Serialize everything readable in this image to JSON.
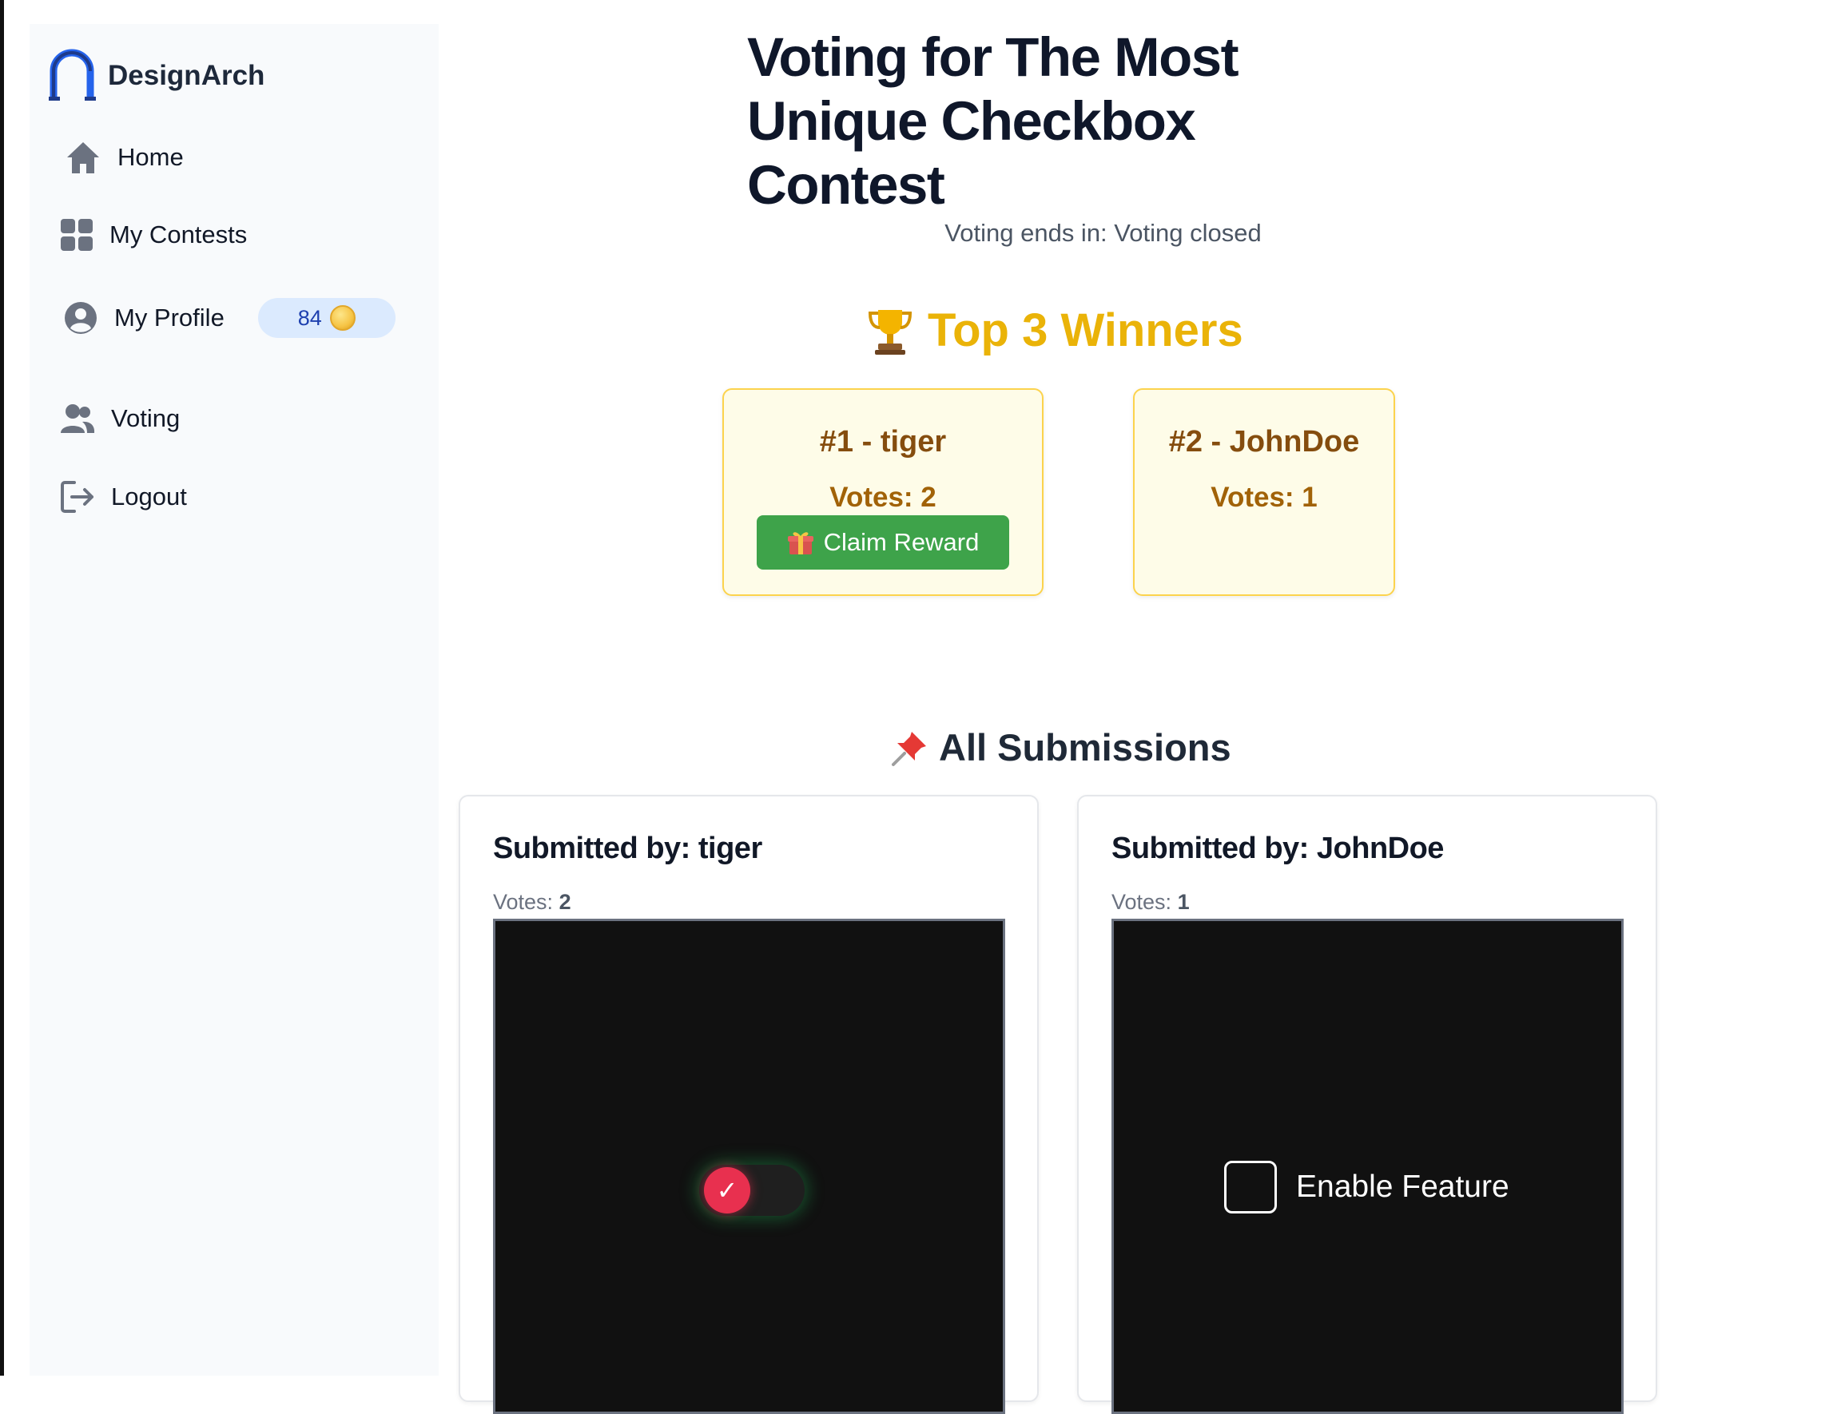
{
  "brand": {
    "name": "DesignArch"
  },
  "sidebar": {
    "items": [
      {
        "label": "Home",
        "icon": "home-icon"
      },
      {
        "label": "My Contests",
        "icon": "grid-icon"
      },
      {
        "label": "My Profile",
        "icon": "user-circle-icon",
        "badge": "84",
        "badge_icon": "coin-icon"
      },
      {
        "label": "Voting",
        "icon": "users-icon"
      },
      {
        "label": "Logout",
        "icon": "logout-icon"
      }
    ]
  },
  "header": {
    "title": "Voting for The Most Unique Checkbox Contest",
    "voting_ends": "Voting ends in: Voting closed"
  },
  "winners": {
    "title": "Top 3 Winners",
    "title_icon": "trophy-icon",
    "items": [
      {
        "title": "#1 - tiger",
        "votes": "Votes: 2",
        "claim_label": "Claim Reward",
        "claim_icon": "gift-icon"
      },
      {
        "title": "#2 - JohnDoe",
        "votes": "Votes: 1"
      }
    ]
  },
  "submissions": {
    "title": "All Submissions",
    "title_icon": "pushpin-icon",
    "items": [
      {
        "title": "Submitted by: tiger",
        "votes_label": "Votes:",
        "votes": "2",
        "preview_check": "✓"
      },
      {
        "title": "Submitted by: JohnDoe",
        "votes_label": "Votes:",
        "votes": "1",
        "preview_label": "Enable Feature"
      }
    ]
  },
  "colors": {
    "accent_gold": "#eab308",
    "claim_green": "#3ea34a",
    "badge_blue": "#dbeafe",
    "toggle_red": "#e8304f"
  }
}
